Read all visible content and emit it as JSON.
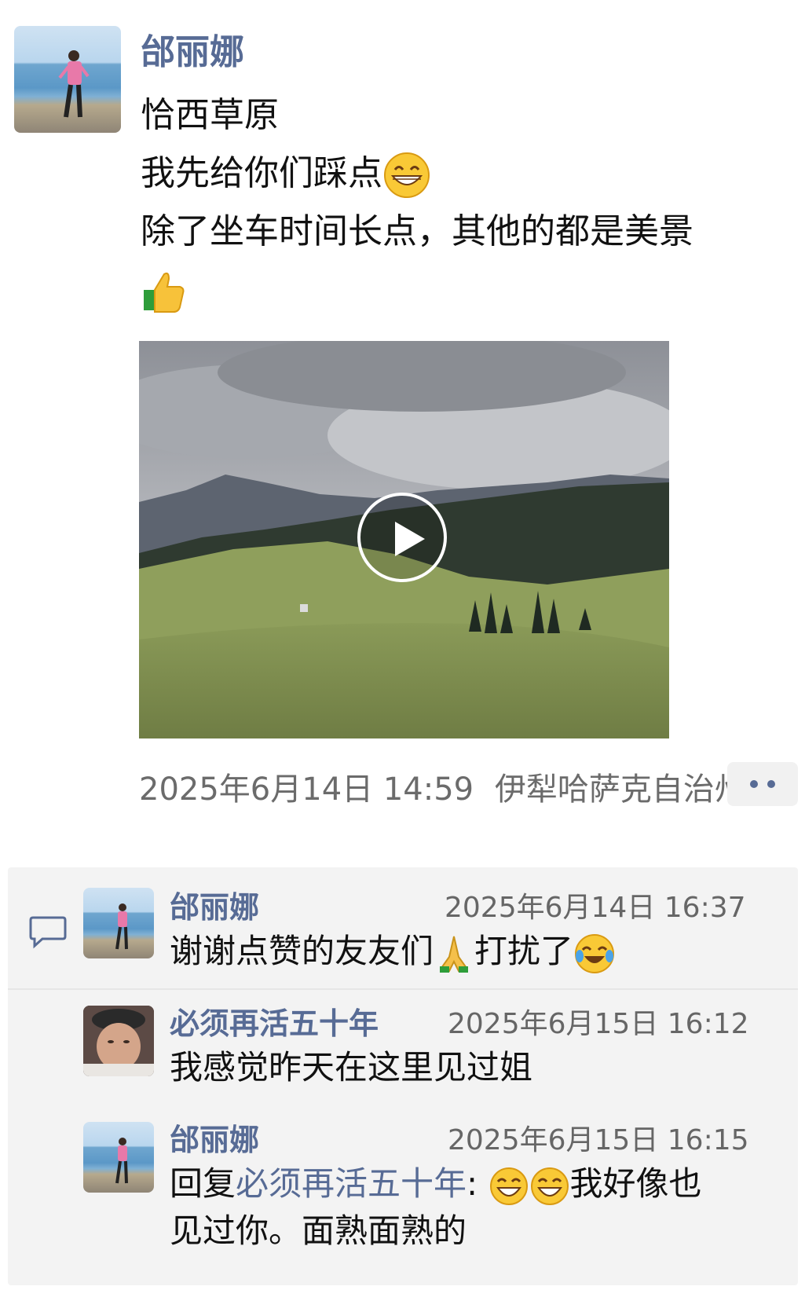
{
  "post": {
    "author": "邰丽娜",
    "lines": [
      "恰西草原",
      "我先给你们踩点",
      "除了坐车时间长点，其他的都是美景"
    ],
    "emojis": [
      "grin-emoji",
      "thumbs-up-emoji"
    ],
    "timestamp": "2025年6月14日 14:59",
    "location": "伊犁哈萨克自治州"
  },
  "comments": [
    {
      "author": "邰丽娜",
      "time": "2025年6月14日 16:37",
      "text_a": "谢谢点赞的友友们",
      "text_b": "打扰了"
    },
    {
      "author": "必须再活五十年",
      "time": "2025年6月15日 16:12",
      "text": "我感觉昨天在这里见过姐"
    },
    {
      "author": "邰丽娜",
      "time": "2025年6月15日 16:15",
      "reply_prefix": "回复",
      "reply_to": "必须再活五十年",
      "reply_colon": ":",
      "text_a": "我好像也",
      "text_b": "见过你。面熟面熟的"
    }
  ],
  "colors": {
    "name_blue": "#576b95",
    "comment_bg": "#f3f3f3"
  }
}
